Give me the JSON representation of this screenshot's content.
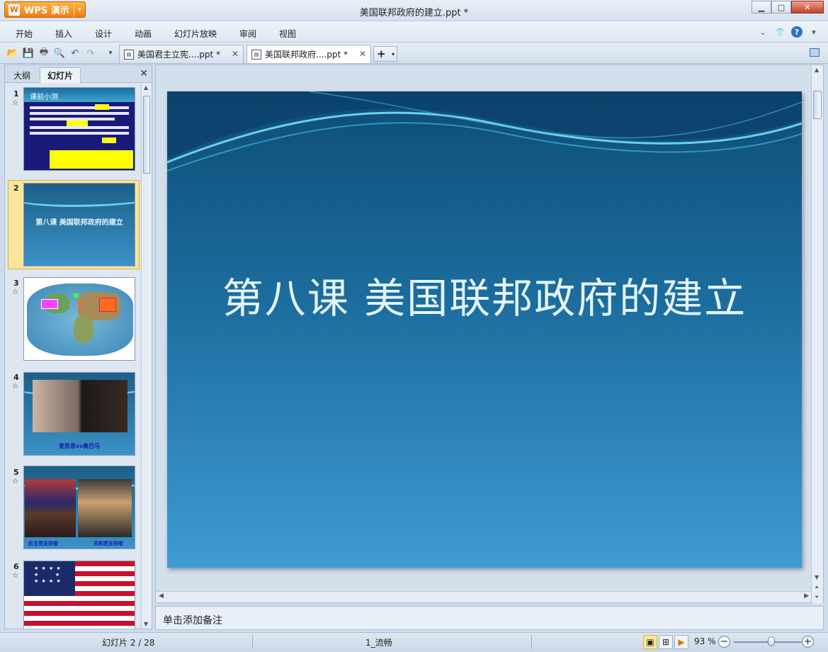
{
  "app": {
    "button_label": "WPS 演示",
    "logo_glyph": "W"
  },
  "window": {
    "title": "美国联邦政府的建立.ppt *",
    "minimize": "▁",
    "maximize": "□",
    "close": "✕"
  },
  "menu": {
    "items": [
      "开始",
      "插入",
      "设计",
      "动画",
      "幻灯片放映",
      "审阅",
      "视图"
    ]
  },
  "doc_tabs": [
    {
      "label": "美国君主立宪....ppt *",
      "active": false
    },
    {
      "label": "美国联邦政府....ppt *",
      "active": true
    }
  ],
  "left_panel": {
    "tabs": [
      "大纲",
      "幻灯片"
    ],
    "active_tab": 1
  },
  "thumbnails": [
    {
      "num": "1",
      "title": "课前小测"
    },
    {
      "num": "2",
      "title": "第八课   美国联邦政府的建立"
    },
    {
      "num": "3"
    },
    {
      "num": "4",
      "caption": "麦凯恩vs奥巴马"
    },
    {
      "num": "5",
      "caption_left": "民主党支持者",
      "caption_right": "共和党支持者"
    },
    {
      "num": "6"
    }
  ],
  "slide": {
    "title": "第八课   美国联邦政府的建立"
  },
  "notes": {
    "placeholder": "单击添加备注"
  },
  "status": {
    "pages": "幻灯片 2 / 28",
    "theme": "1_流畅",
    "zoom": "93 %",
    "zoom_level": 0.55
  },
  "colors": {
    "accent": "#f07d10",
    "slide_top": "#0e4d78",
    "slide_bottom": "#3e9bd3"
  }
}
